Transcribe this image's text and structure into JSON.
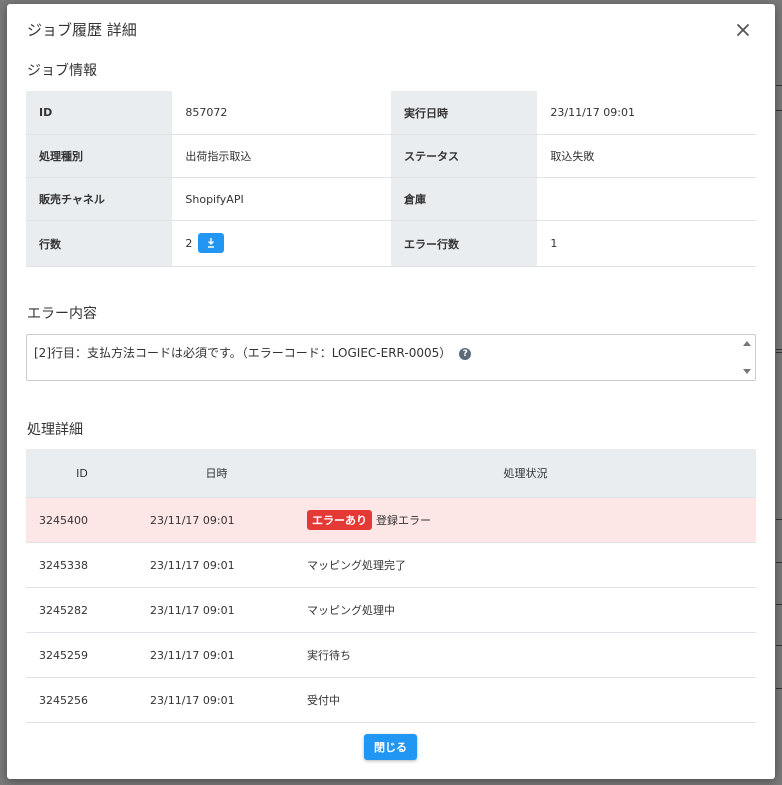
{
  "modal": {
    "title": "ジョブ履歴 詳細",
    "close_icon": "close-icon"
  },
  "job_info": {
    "section_title": "ジョブ情報",
    "rows": [
      {
        "label1": "ID",
        "value1": "857072",
        "label2": "実行日時",
        "value2": "23/11/17 09:01"
      },
      {
        "label1": "処理種別",
        "value1": "出荷指示取込",
        "label2": "ステータス",
        "value2": "取込失敗"
      },
      {
        "label1": "販売チャネル",
        "value1": "ShopifyAPI",
        "label2": "倉庫",
        "value2": ""
      },
      {
        "label1": "行数",
        "value1": "2",
        "label2": "エラー行数",
        "value2": "1"
      }
    ],
    "download_icon": "download-icon",
    "download_color": "#2196f3"
  },
  "error_content": {
    "section_title": "エラー内容",
    "text": "[2]行目：支払方法コードは必須です。（エラーコード：LOGIEC-ERR-0005）",
    "help_icon": "?"
  },
  "process_detail": {
    "section_title": "処理詳細",
    "headers": [
      "ID",
      "日時",
      "処理状況"
    ],
    "rows": [
      {
        "id": "3245400",
        "date": "23/11/17 09:01",
        "badge": "エラーあり",
        "status": "登録エラー"
      },
      {
        "id": "3245338",
        "date": "23/11/17 09:01",
        "badge": "",
        "status": "マッピング処理完了"
      },
      {
        "id": "3245282",
        "date": "23/11/17 09:01",
        "badge": "",
        "status": "マッピング処理中"
      },
      {
        "id": "3245259",
        "date": "23/11/17 09:01",
        "badge": "",
        "status": "実行待ち"
      },
      {
        "id": "3245256",
        "date": "23/11/17 09:01",
        "badge": "",
        "status": "受付中"
      }
    ],
    "error_row_color": "#fde6e6",
    "badge_color": "#e53935"
  },
  "footer": {
    "close_label": "閉じる"
  }
}
